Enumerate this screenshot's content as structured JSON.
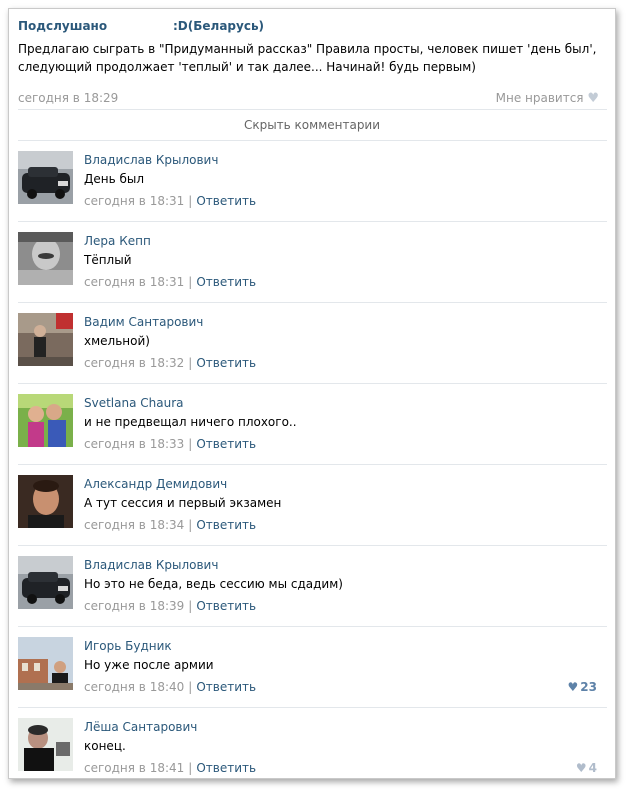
{
  "post": {
    "group": "Подслушано",
    "suffix": ":D(Беларусь)",
    "text": "Предлагаю сыграть в \"Придуманный рассказ\" Правила просты, человек пишет 'день был', следующий продолжает 'теплый' и так далее... Начинай! будь первым)",
    "time": "сегодня в 18:29",
    "like_label": "Мне нравится"
  },
  "hide_comments": "Скрыть комментарии",
  "reply_label": "Ответить",
  "separator": "|",
  "colors": {
    "link": "#2b587a",
    "meta": "#999999",
    "like_active": "#5e82a8",
    "like_inactive": "#b0bccb"
  },
  "comments": [
    {
      "author": "Владислав Крылович",
      "text": "День был",
      "time": "сегодня в 18:31",
      "likes": ""
    },
    {
      "author": "Лера Кепп",
      "text": "Тёплый",
      "time": "сегодня в 18:31",
      "likes": ""
    },
    {
      "author": "Вадим Сантарович",
      "text": "хмельной)",
      "time": "сегодня в 18:32",
      "likes": ""
    },
    {
      "author": "Svetlana Chaura",
      "text": "и не предвещал ничего плохого..",
      "time": "сегодня в 18:33",
      "likes": ""
    },
    {
      "author": "Александр Демидович",
      "text": "А тут сессия и первый экзамен",
      "time": "сегодня в 18:34",
      "likes": ""
    },
    {
      "author": "Владислав Крылович",
      "text": "Но это не беда, ведь сессию мы сдадим)",
      "time": "сегодня в 18:39",
      "likes": ""
    },
    {
      "author": "Игорь Будник",
      "text": "Но уже после армии",
      "time": "сегодня в 18:40",
      "likes": "23"
    },
    {
      "author": "Лёша Сантарович",
      "text": "конец.",
      "time": "сегодня в 18:41",
      "likes": "4"
    }
  ]
}
